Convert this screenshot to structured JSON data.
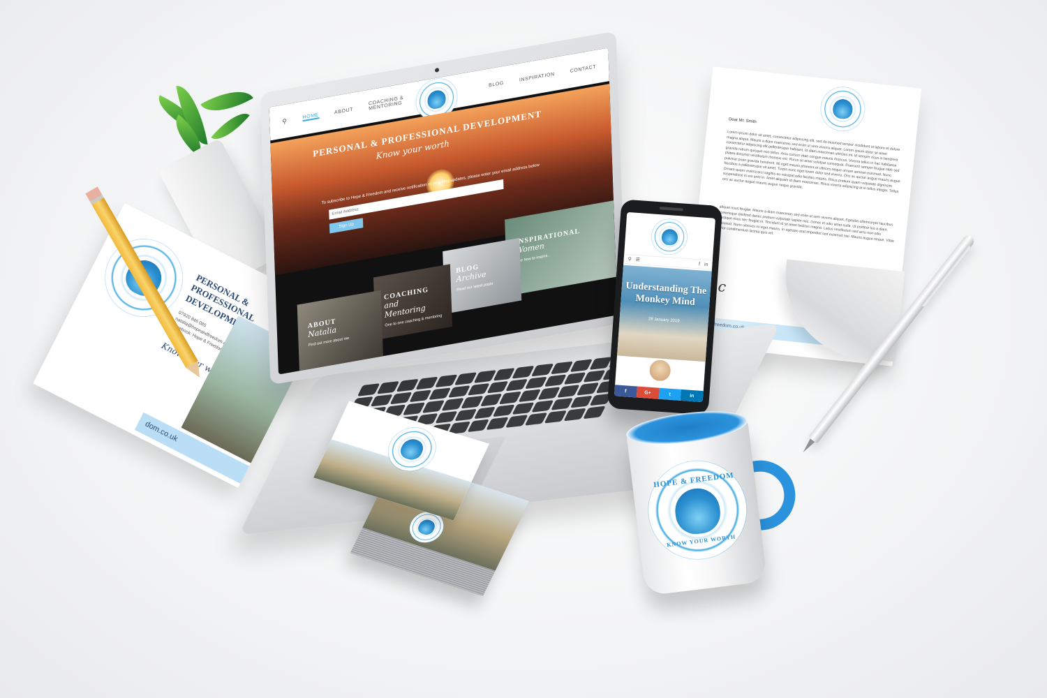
{
  "brand": {
    "name": "HOPE & FREEDOM",
    "tagline": "KNOW YOUR WORTH"
  },
  "colors": {
    "accent": "#3aa7dd",
    "navy": "#2b4a75",
    "light_blue": "#b9def5"
  },
  "laptop": {
    "nav": [
      "HOME",
      "ABOUT",
      "COACHING & MENTORING",
      "BLOG",
      "INSPIRATION",
      "CONTACT"
    ],
    "hero": {
      "title": "PERSONAL & PROFESSIONAL DEVELOPMENT",
      "tagline": "Know your worth",
      "subscribe_text": "To subscribe to Hope & Freedom and receive notification of new blog updates, please enter your email address below",
      "email_placeholder": "Email Address",
      "signup_label": "Sign Up"
    },
    "tiles": {
      "inspire": {
        "title": "INSPIRATIONAL",
        "script": "Women",
        "sub": "See how to inspire..."
      },
      "blog": {
        "title": "BLOG",
        "script": "Archive",
        "sub": "Read our latest posts"
      },
      "coaching": {
        "title": "COACHING",
        "script": "and Mentoring",
        "sub": "One to one coaching & mentoring"
      },
      "about": {
        "title": "ABOUT",
        "script": "Natalia",
        "sub": "Find out more about me"
      }
    }
  },
  "flyer": {
    "heading": "PERSONAL & PROFESSIONAL DEVELOPMENT COACHING",
    "phone": "07920 846 085",
    "email": "natalia@hopeandfreedom.co.uk",
    "facebook": "Facebook: Hope & Freedom",
    "tagline": "Know your worth",
    "url": "dom.co.uk"
  },
  "letter": {
    "salutation": "Dear Mr. Smith",
    "body_1": "Lorem ipsum dolor sit amet, consectetur adipiscing elit, sed do eiusmod tempor incididunt ut labore et dolore magna aliqua. Mauris a diam maecenas sed enim ut sem viverra aliquet. Lorem ipsum dolor sit amet consectetur adipiscing elit pellentesque habitant. Id diam maecenas ultricies mi. Id semper risus in hendrerit gravida rutrum quisque non tellus. Arcu cursus vitae congue mauris rhoncus. Viverra tellus in hac habitasse platea dictumst vestibulum rhoncus est. Purus sit amet volutpat consequat. Praesent semper feugiat nibh sed pulvinar proin gravida hendrerit. Mi eget mauris pharetra et ultrices neque ornare aenean euismod. Nunc faucibus a pellentesque sit amet. Turpis nunc eget lorem dolor sed viverra. Orci ac auctor augue mauris augue. Ornare quam viverra orci sagittis eu volutpat odio facilisis mauris. Risus pretium quam vulputate dignissim suspendisse in est ante in. Amet aliquam id diam maecenas. Risus viverra adipiscing at in tellus integer. Tellus orci ac auctor augue mauris augue neque gravida.",
    "body_2": "aliquet risus feugiat. Mauris a diam maecenas sed enim ut sem viverra aliquet. Egestas ullamcorper faucibus scelerisque eleifend donec pretium vulputate sapien nec. Donec et odio amet nulla. Ut porttitor leo a diam. Tristique risus nec feugiat in. Tincidunt id sit amet facilisis magna. Lacus vestibulum sed arcu non odio euismod. Nunc ultricies mi eget mauris. In egestas erat imperdiet sed euismod nisi. Mauris augue neque. Vitae tortor condimentum lacinia quis vel.",
    "signoff": "c",
    "url": "hopeandfreedom.co.uk"
  },
  "phone": {
    "post_title": "Understanding The Monkey Mind",
    "post_date": "28 January 2019",
    "share": [
      "f",
      "G+",
      "t",
      "in"
    ],
    "share_colors": [
      "#3b5998",
      "#dd4b39",
      "#1da1f2",
      "#0077b5"
    ]
  },
  "icons": {
    "search": "search-icon",
    "menu": "menu-icon",
    "facebook": "facebook-icon",
    "linkedin": "linkedin-icon",
    "camera": "camera-icon"
  }
}
